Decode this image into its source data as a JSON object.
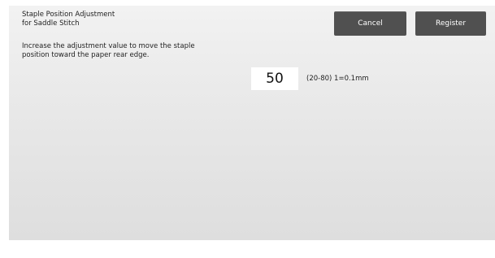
{
  "screen": {
    "title": "Staple Position Adjustment\nfor Saddle Stitch",
    "description": "Increase the adjustment value to move the staple position toward the paper rear edge."
  },
  "buttons": {
    "cancel_label": "Cancel",
    "register_label": "Register"
  },
  "adjustment": {
    "value": "50",
    "range_text": "(20-80) 1=0.1mm"
  },
  "colors": {
    "button_bg": "#505050",
    "panel_bg": "#e9e9e9",
    "value_box_bg": "#ffffff"
  }
}
